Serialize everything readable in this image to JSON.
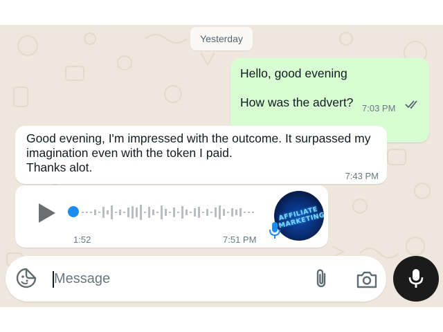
{
  "date_divider": "Yesterday",
  "messages": [
    {
      "direction": "outgoing",
      "lines": [
        "Hello, good evening",
        "How was the advert?"
      ],
      "time": "7:03 PM",
      "status": "read"
    },
    {
      "direction": "incoming",
      "text": "Good evening, I'm impressed with the outcome. It surpassed my imagination even with the token I paid.\nThanks alot.",
      "time": "7:43 PM"
    },
    {
      "direction": "incoming",
      "type": "voice",
      "duration": "1:52",
      "time": "7:51 PM",
      "progress": 0,
      "avatar_text": [
        "AFFILIATE",
        "MARKETING"
      ]
    }
  ],
  "composer": {
    "placeholder": "Message",
    "icons": [
      "emoji-icon",
      "paperclip-icon",
      "camera-icon",
      "mic-icon"
    ]
  },
  "colors": {
    "outgoing_bubble": "#d9fdd3",
    "incoming_bubble": "#ffffff",
    "chat_background": "#efe7dd",
    "voice_accent": "#1d8cf0",
    "mic_button": "#1b1b1b"
  }
}
